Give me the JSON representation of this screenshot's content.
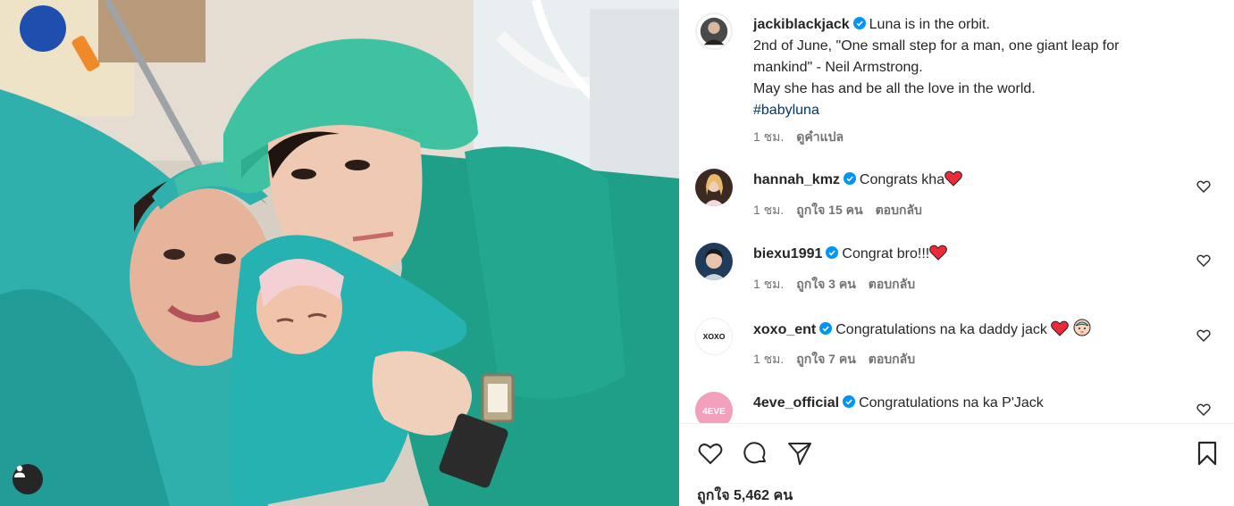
{
  "post": {
    "username": "jackiblackjack",
    "caption_line1": "Luna is in the orbit.",
    "caption_line2": "2nd of June, \"One small step for a man, one giant leap for",
    "caption_line3": "mankind\" - Neil Armstrong.",
    "caption_line4": "May she has and be all the love in the world.",
    "hashtag": "#babyluna",
    "time": "1 ชม.",
    "translate": "ดูคำแปล"
  },
  "comments": [
    {
      "username": "hannah_kmz",
      "text": "Congrats kha",
      "emoji": "red-heart",
      "time": "1 ชม.",
      "likes": "ถูกใจ 15 คน",
      "reply": "ตอบกลับ"
    },
    {
      "username": "biexu1991",
      "text": "Congrat bro!!!",
      "emoji": "red-heart",
      "time": "1 ชม.",
      "likes": "ถูกใจ 3 คน",
      "reply": "ตอบกลับ"
    },
    {
      "username": "xoxo_ent",
      "text": "Congratulations na ka daddy jack",
      "emoji": "red-heart + baby-face",
      "time": "1 ชม.",
      "likes": "ถูกใจ 7 คน",
      "reply": "ตอบกลับ"
    },
    {
      "username": "4eve_official",
      "text": "Congratulations na ka P'Jack"
    }
  ],
  "avatars": {
    "xoxo_ent": "XOXO",
    "4eve_official": "4EVE"
  },
  "likes_count": "ถูกใจ 5,462 คน",
  "colors": {
    "verified": "#0095f6",
    "heart": "#ed2a3a",
    "scrubs": "#1f9e88",
    "drape": "#2db3b0"
  }
}
